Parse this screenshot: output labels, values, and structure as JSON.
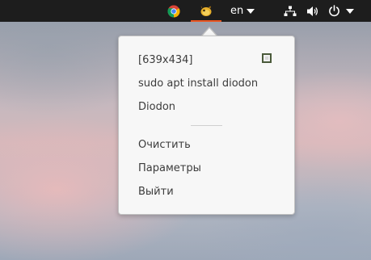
{
  "panel": {
    "language": "en",
    "tray_icons": [
      "chrome-icon",
      "diodon-icon",
      "network-icon",
      "volume-icon",
      "power-icon"
    ],
    "accent_color": "#e95420"
  },
  "diodon_menu": {
    "clipboard_items": [
      "[639x434]",
      "sudo apt install diodon",
      "Diodon"
    ],
    "actions": {
      "clear": "Очистить",
      "preferences": "Параметры",
      "quit": "Выйти"
    }
  }
}
